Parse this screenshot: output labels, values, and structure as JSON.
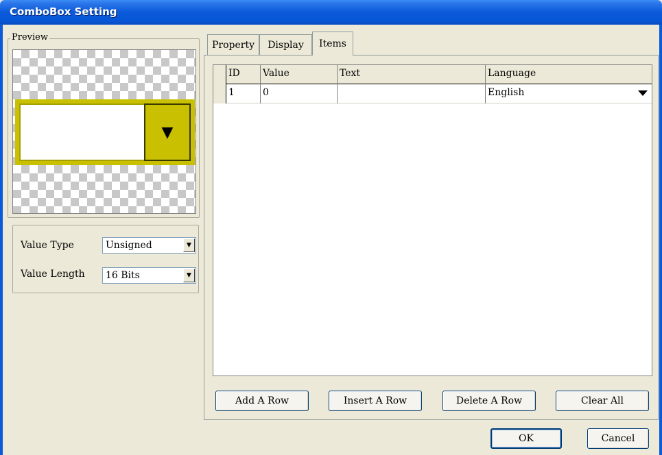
{
  "window": {
    "title": "ComboBox Setting"
  },
  "preview": {
    "legend": "Preview"
  },
  "value_settings": {
    "value_type_label": "Value Type",
    "value_type": "Unsigned",
    "value_length_label": "Value Length",
    "value_length": "16 Bits"
  },
  "tabs": [
    {
      "label": "Property"
    },
    {
      "label": "Display"
    },
    {
      "label": "Items"
    }
  ],
  "grid": {
    "columns": [
      "ID",
      "Value",
      "Text",
      "Language"
    ],
    "rows": [
      {
        "id": "1",
        "value": "0",
        "text": "",
        "language": "English"
      }
    ]
  },
  "item_buttons": {
    "add": "Add A Row",
    "insert": "Insert A Row",
    "delete": "Delete A Row",
    "clear": "Clear All"
  },
  "dialog_buttons": {
    "ok": "OK",
    "cancel": "Cancel"
  },
  "colors": {
    "preview_fill": "#c8c000",
    "titlebar": "#0a5adb"
  }
}
